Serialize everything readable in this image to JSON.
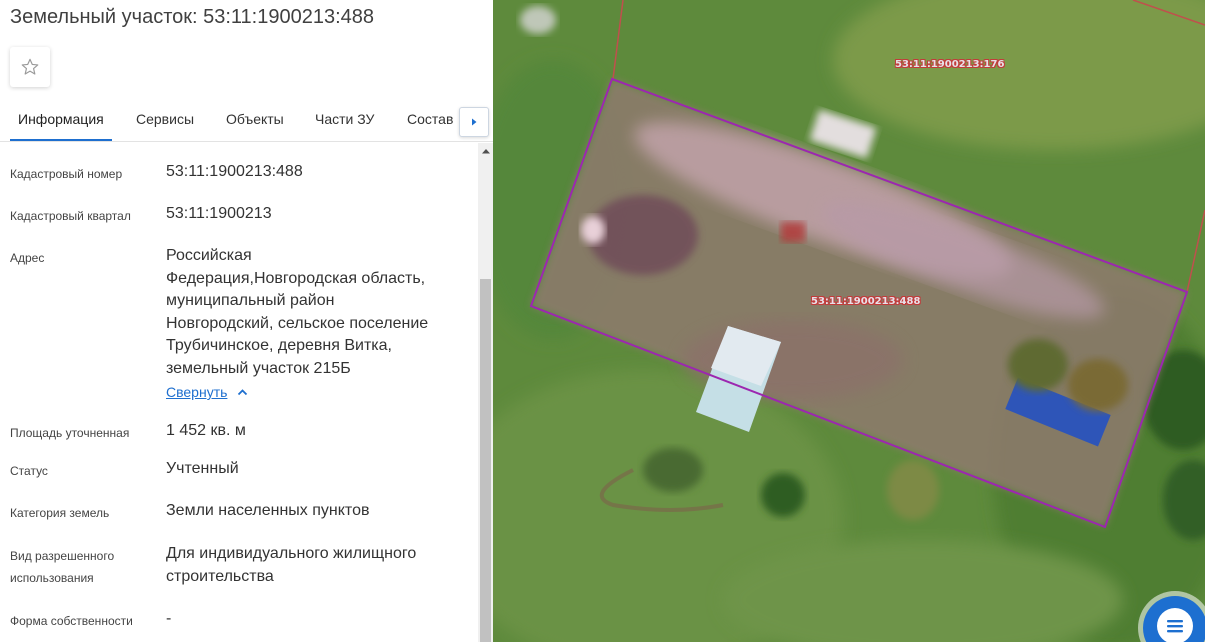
{
  "panel": {
    "title": "Земельный участок: 53:11:1900213:488",
    "favorite_icon": "star-outline-icon",
    "tabs": [
      {
        "label": "Информация",
        "active": true
      },
      {
        "label": "Сервисы"
      },
      {
        "label": "Объекты"
      },
      {
        "label": "Части ЗУ"
      },
      {
        "label": "Состав"
      }
    ],
    "tabs_next_icon": "chevron-right-icon",
    "fields": {
      "cadastral_number": {
        "label": "Кадастровый номер",
        "value": "53:11:1900213:488"
      },
      "cadastral_quarter": {
        "label": "Кадастровый квартал",
        "value": "53:11:1900213"
      },
      "address": {
        "label": "Адрес",
        "value_lines": [
          "Российская",
          "Федерация,Новгородская область,",
          "муниципальный район",
          "Новгородский, сельское поселение",
          "Трубичинское, деревня Витка,",
          "земельный участок 215Б"
        ],
        "collapse_label": "Свернуть"
      },
      "area": {
        "label": "Площадь уточненная",
        "value": "1 452 кв. м"
      },
      "status": {
        "label": "Статус",
        "value": "Учтенный"
      },
      "land_category": {
        "label": "Категория земель",
        "value": "Земли населенных пунктов"
      },
      "permitted_use": {
        "label_lines": [
          "Вид разрешенного",
          "использования"
        ],
        "value_lines": [
          "Для индивидуального жилищного",
          "строительства"
        ]
      },
      "ownership": {
        "label": "Форма собственности",
        "value": "-"
      }
    }
  },
  "map": {
    "parcel_labels": {
      "selected": "53:11:1900213:488",
      "neighbor": "53:11:1900213:176"
    },
    "selected_parcel_color": "#9c27b0",
    "neighbor_boundary_color": "#c0504d",
    "menu_button_icon": "list-menu-icon",
    "accent_color": "#1d6fd0"
  }
}
